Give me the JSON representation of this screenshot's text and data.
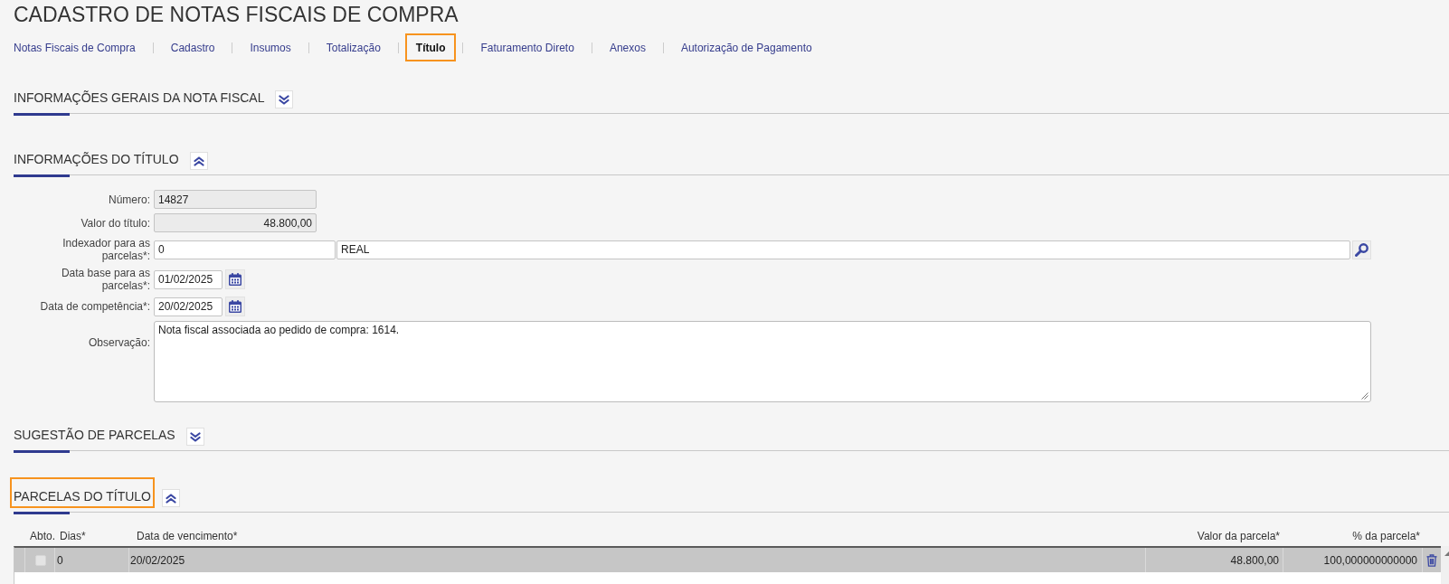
{
  "page_title": "CADASTRO DE NOTAS FISCAIS DE COMPRA",
  "tabs": [
    {
      "label": "Notas Fiscais de Compra",
      "selected": false
    },
    {
      "label": "Cadastro",
      "selected": false
    },
    {
      "label": "Insumos",
      "selected": false
    },
    {
      "label": "Totalização",
      "selected": false
    },
    {
      "label": "Título",
      "selected": true
    },
    {
      "label": "Faturamento Direto",
      "selected": false
    },
    {
      "label": "Anexos",
      "selected": false
    },
    {
      "label": "Autorização de Pagamento",
      "selected": false
    }
  ],
  "sections": [
    {
      "title": "INFORMAÇÕES GERAIS DA NOTA FISCAL",
      "expanded": false,
      "highlighted": false
    },
    {
      "title": "INFORMAÇÕES DO TÍTULO",
      "expanded": true,
      "highlighted": false,
      "fields": [
        {
          "kind": "readonly",
          "label": "Número:",
          "value": "14827"
        },
        {
          "kind": "readonly_amount",
          "label": "Valor do título:",
          "value": "48.800,00"
        },
        {
          "kind": "lookup",
          "label": "Indexador para as parcelas*:",
          "code": "0",
          "description": "REAL"
        },
        {
          "kind": "date",
          "label": "Data base para as parcelas*:",
          "value": "01/02/2025"
        },
        {
          "kind": "date",
          "label": "Data de competência*:",
          "value": "20/02/2025"
        },
        {
          "kind": "textarea",
          "label": "Observação:",
          "value": "Nota fiscal associada ao pedido de compra: 1614."
        }
      ]
    },
    {
      "title": "SUGESTÃO DE PARCELAS",
      "expanded": false,
      "highlighted": false
    },
    {
      "title": "PARCELAS DO TÍTULO",
      "expanded": true,
      "highlighted": true,
      "table": {
        "columns": [
          "Abto.",
          "Dias*",
          "Data de vencimento*",
          "Valor da parcela*",
          "% da parcela*"
        ],
        "rows": [
          {
            "selected": true,
            "checked": false,
            "dias": "0",
            "vencimento": "20/02/2025",
            "valor": "48.800,00",
            "percentual": "100,000000000000"
          }
        ]
      }
    }
  ]
}
